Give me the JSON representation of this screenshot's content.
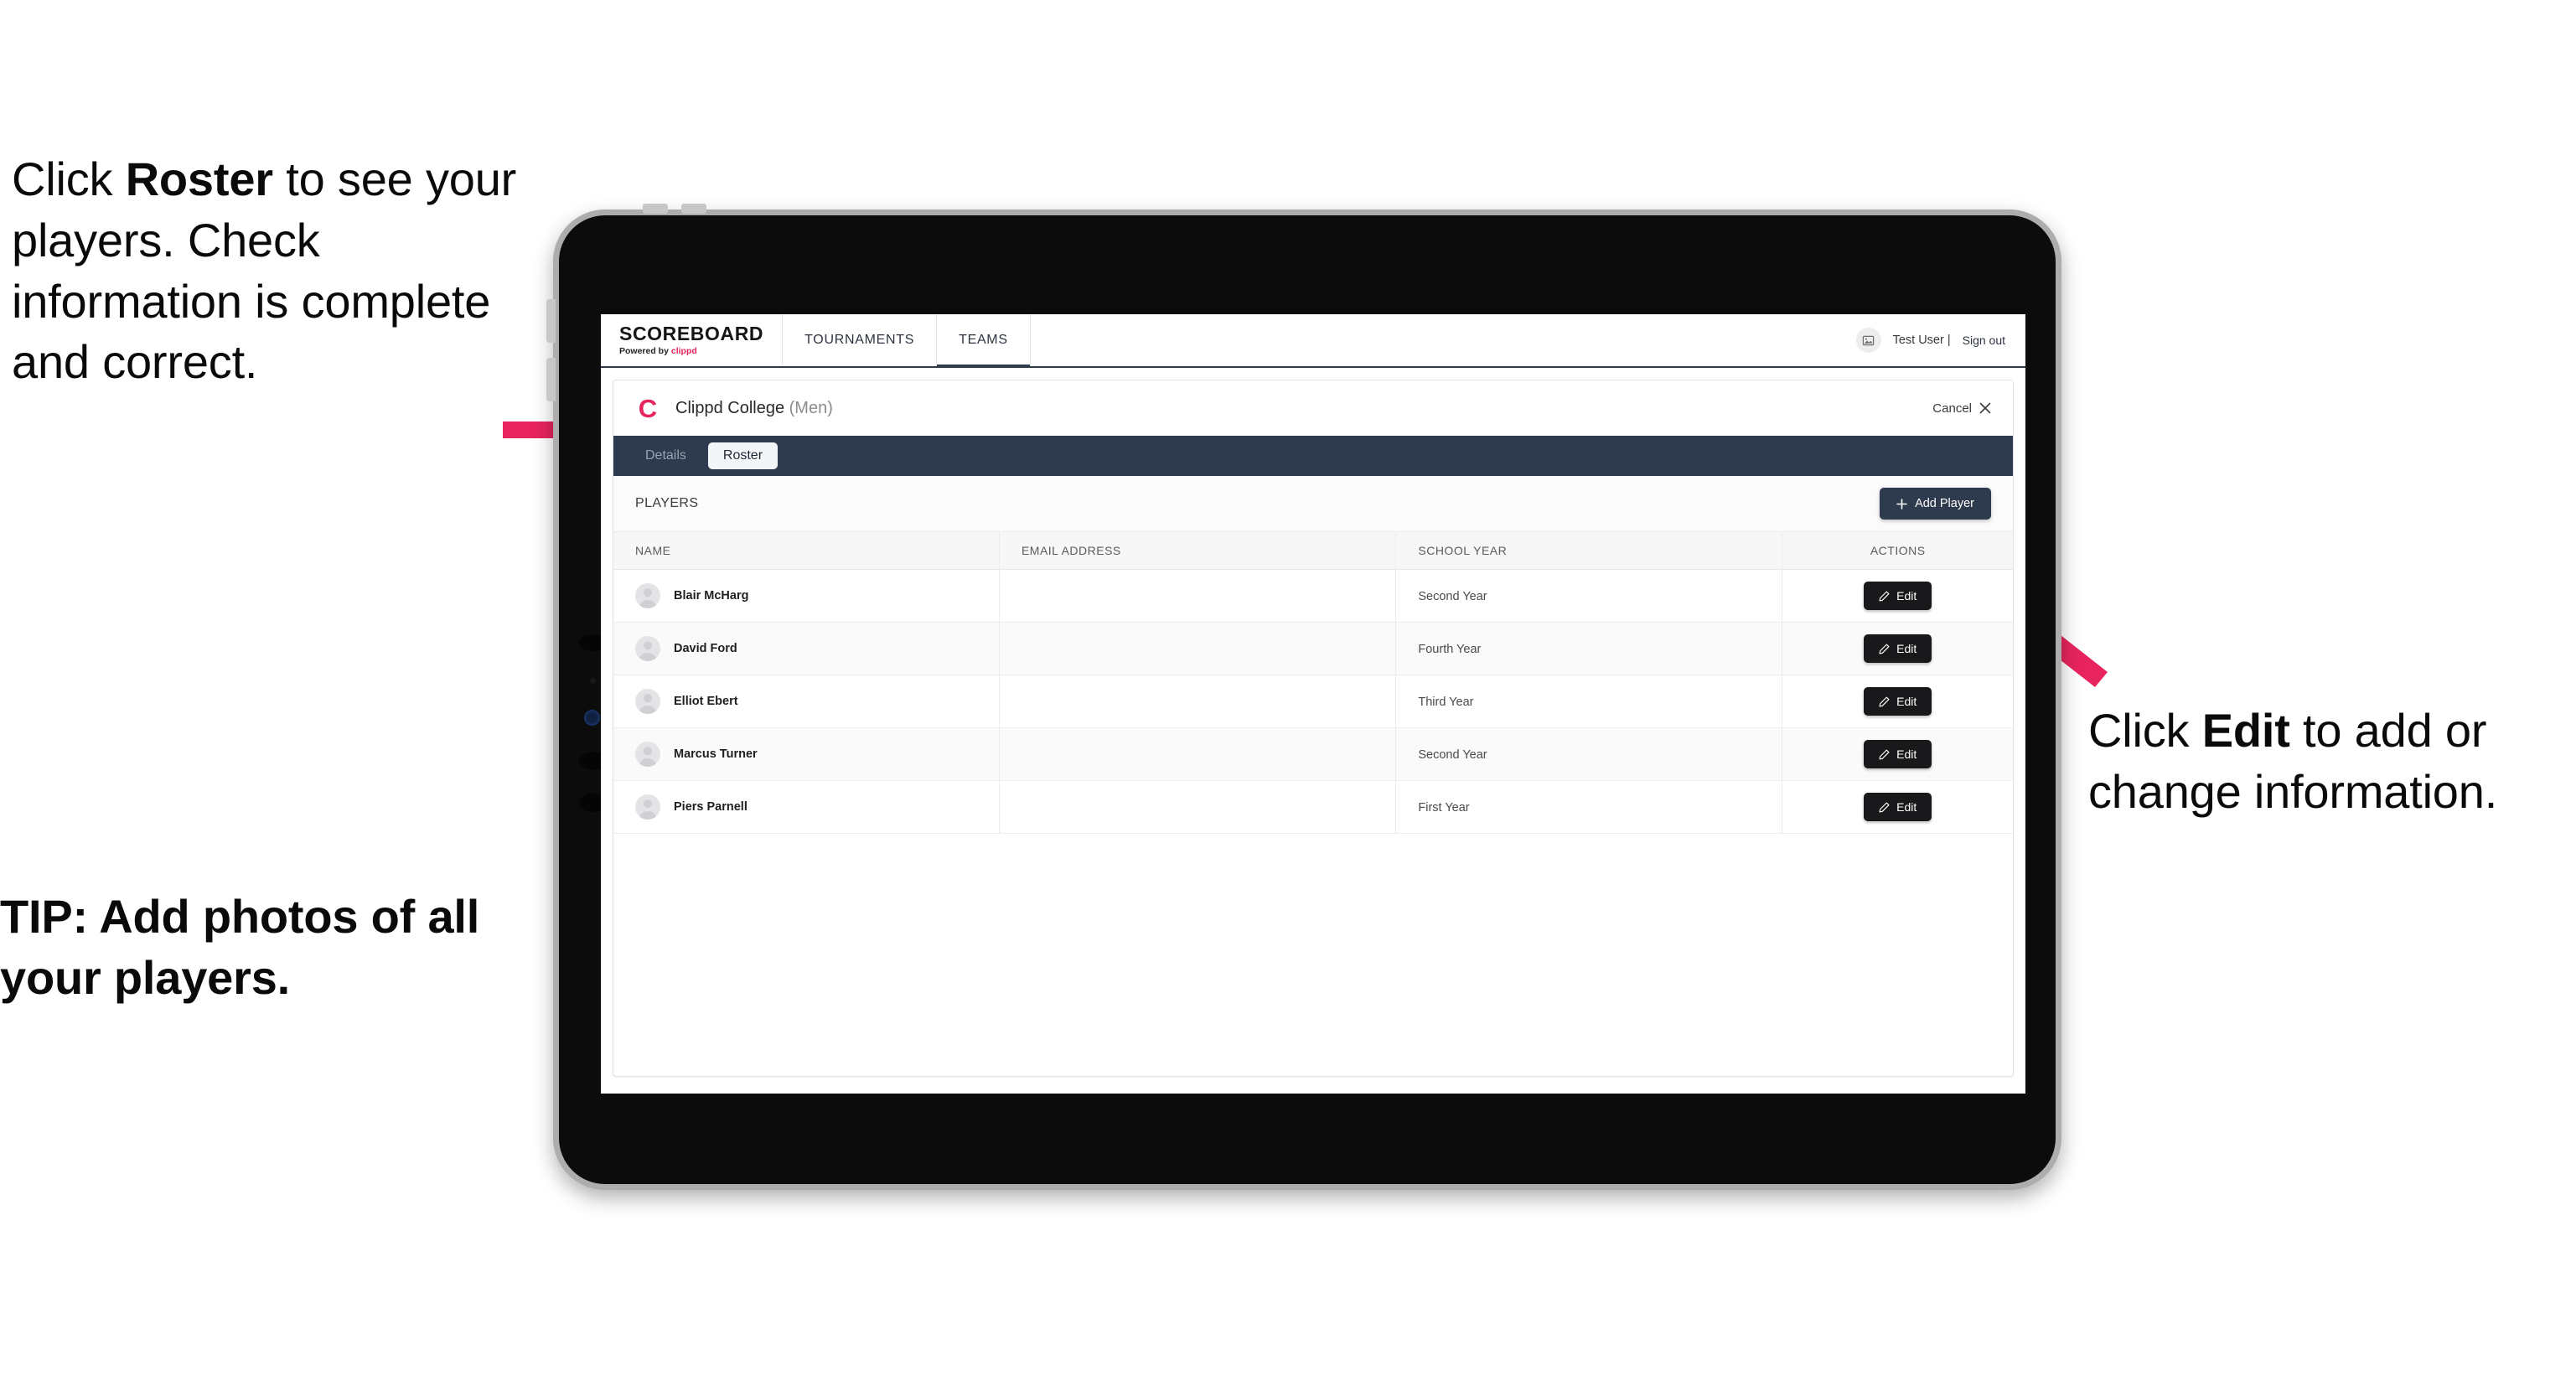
{
  "annotations": {
    "left_top": {
      "pre": "Click ",
      "bold": "Roster",
      "post": " to see your players. Check information is complete and correct."
    },
    "left_tip": "TIP: Add photos of all your players.",
    "right": {
      "pre": "Click ",
      "bold": "Edit",
      "post": " to add or change information."
    }
  },
  "app": {
    "brand": {
      "title": "SCOREBOARD",
      "sub_prefix": "Powered by ",
      "sub_brand": "clippd"
    },
    "nav_tabs": [
      {
        "label": "TOURNAMENTS",
        "active": false
      },
      {
        "label": "TEAMS",
        "active": true
      }
    ],
    "account": {
      "avatar_icon": "image-placeholder-icon",
      "user": "Test User |",
      "sign_out": "Sign out"
    },
    "team": {
      "logo_glyph": "C",
      "name": "Clippd College",
      "gender": "(Men)",
      "cancel_label": "Cancel",
      "cancel_icon": "close-icon"
    },
    "segments": [
      {
        "label": "Details",
        "active": false
      },
      {
        "label": "Roster",
        "active": true
      }
    ],
    "players_panel": {
      "title": "PLAYERS",
      "add_button": {
        "icon": "plus-icon",
        "label": "Add Player"
      },
      "columns": [
        "NAME",
        "EMAIL ADDRESS",
        "SCHOOL YEAR",
        "ACTIONS"
      ],
      "rows": [
        {
          "name": "Blair McHarg",
          "email": "",
          "school_year": "Second Year",
          "action_label": "Edit"
        },
        {
          "name": "David Ford",
          "email": "",
          "school_year": "Fourth Year",
          "action_label": "Edit"
        },
        {
          "name": "Elliot Ebert",
          "email": "",
          "school_year": "Third Year",
          "action_label": "Edit"
        },
        {
          "name": "Marcus Turner",
          "email": "",
          "school_year": "Second Year",
          "action_label": "Edit"
        },
        {
          "name": "Piers Parnell",
          "email": "",
          "school_year": "First Year",
          "action_label": "Edit"
        }
      ]
    }
  },
  "colors": {
    "accent_pink": "#e8245e",
    "navy": "#2e3a4d",
    "button_black": "#19191b",
    "device_frame": "#0c0c0c"
  }
}
